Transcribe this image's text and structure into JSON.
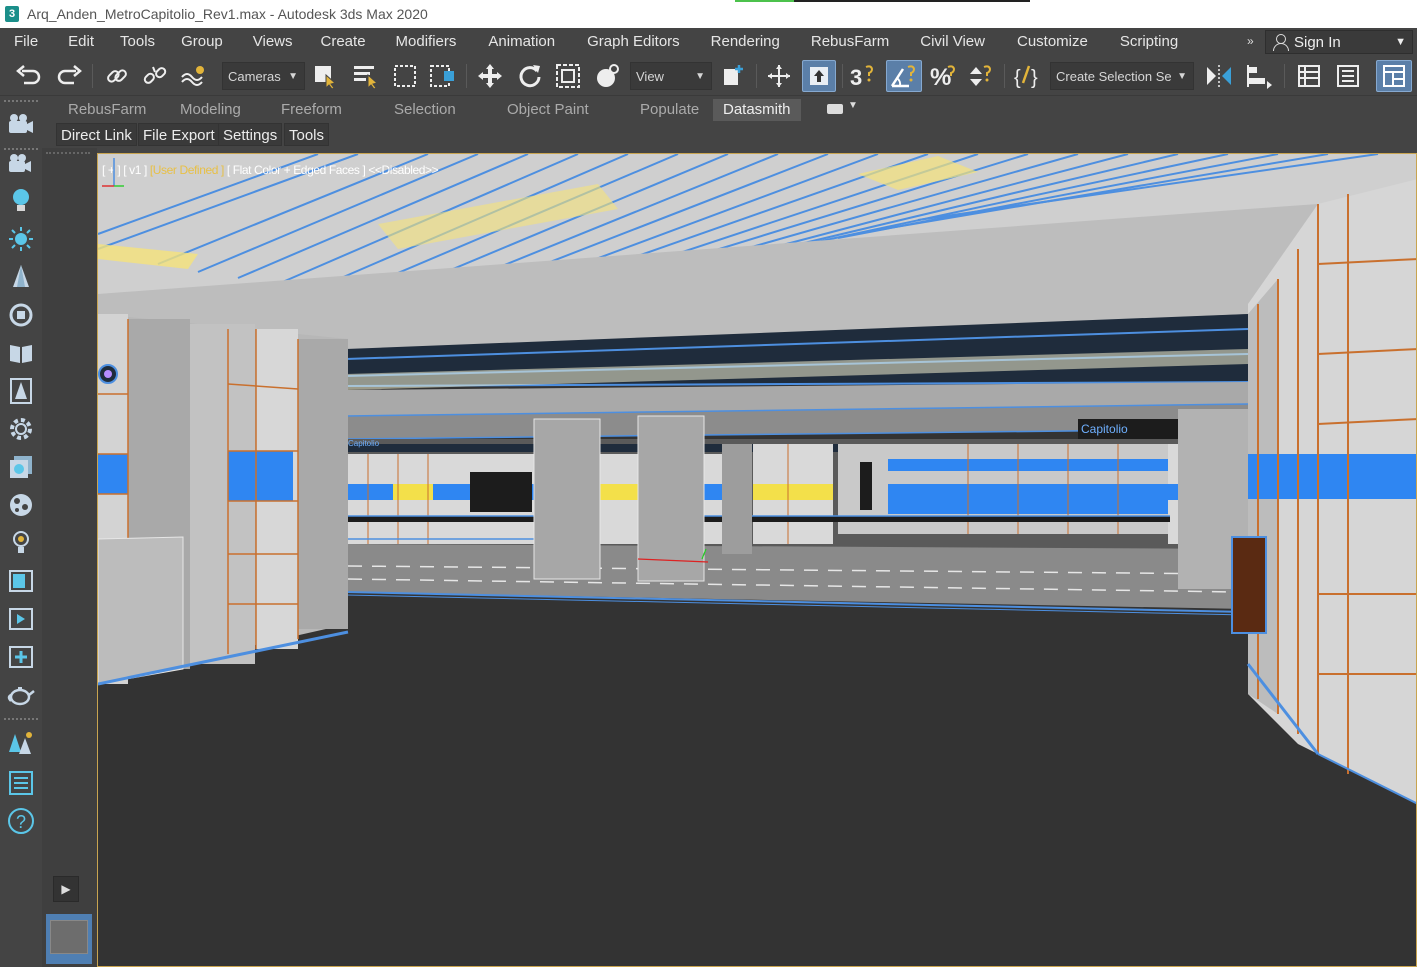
{
  "window": {
    "title": "Arq_Anden_MetroCapitolio_Rev1.max - Autodesk 3ds Max 2020",
    "app_icon_glyph": "3"
  },
  "menu": {
    "items": [
      "File",
      "Edit",
      "Tools",
      "Group",
      "Views",
      "Create",
      "Modifiers",
      "Animation",
      "Graph Editors",
      "Rendering",
      "RebusFarm",
      "Civil View",
      "Customize",
      "Scripting"
    ],
    "more": "»",
    "sign_in": "Sign In"
  },
  "toolbar": {
    "selection_filter": "Cameras",
    "reference_coord": "View",
    "named_selection": "Create Selection Se",
    "icons": [
      "undo-icon",
      "redo-icon",
      "link-icon",
      "unlink-icon",
      "bind-space-warp-icon",
      "select-object-icon",
      "select-by-name-icon",
      "rectangle-selection-icon",
      "window-crossing-icon",
      "move-icon",
      "rotate-icon",
      "scale-icon",
      "place-icon",
      "pivot-icon",
      "manipulate-icon",
      "keyboard-shortcut-icon",
      "snaps-toggle-icon",
      "angle-snap-icon",
      "percent-snap-icon",
      "spinner-snap-icon",
      "edit-named-sets-icon",
      "mirror-icon",
      "align-icon",
      "scene-explorer-icon",
      "layer-explorer-icon",
      "toggle-ribbon-icon"
    ]
  },
  "ribbon": {
    "tabs": [
      "RebusFarm",
      "Modeling",
      "Freeform",
      "Selection",
      "Object Paint",
      "Populate",
      "Datasmith"
    ],
    "active_tab": "Datasmith",
    "subtabs": [
      "Direct Link",
      "File Export",
      "Settings",
      "Tools"
    ]
  },
  "viewport": {
    "label_plus": "[ + ]",
    "label_view": "[ v1 ]",
    "label_camera": "[User Defined ]",
    "label_shading": "[ Flat Color + Edged Faces ]",
    "label_state": "<<Disabled>>",
    "station_sign": "Capitolio",
    "station_sign_small": "Capitolio"
  },
  "colors": {
    "accent_active": "#5b7fa8",
    "viewport_label_highlight": "#e8c046",
    "edge_blue": "#3f8dff",
    "wall_orange": "#c9702e",
    "panel_blue": "#2f86f2",
    "panel_yellow": "#f3e04a"
  }
}
